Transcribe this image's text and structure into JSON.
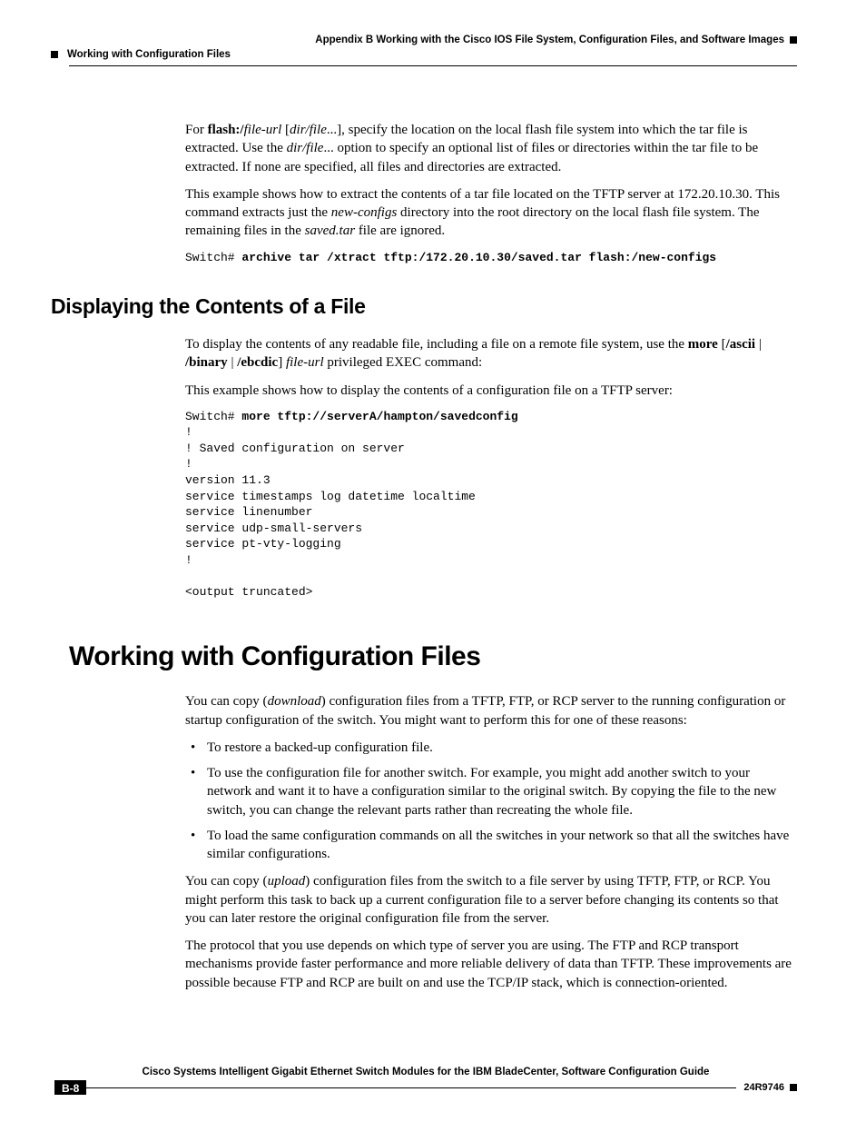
{
  "header": {
    "appendix": "Appendix B      Working with the Cisco IOS File System, Configuration Files, and Software Images",
    "section": "Working with Configuration Files"
  },
  "intro": {
    "p1_pre": "For ",
    "p1_b1": "flash:/",
    "p1_i1": "file-url",
    "p1_mid1": " [",
    "p1_i2": "dir/file",
    "p1_mid2": "...], specify the location on the local flash file system into which the tar file is extracted. Use the ",
    "p1_i3": "dir/file",
    "p1_tail": "... option to specify an optional list of files or directories within the tar file to be extracted. If none are specified, all files and directories are extracted.",
    "p2_pre": "This example shows how to extract the contents of a tar file located on the TFTP server at 172.20.10.30. This command extracts just the ",
    "p2_i1": "new-configs",
    "p2_mid": " directory into the root directory on the local flash file system. The remaining files in the ",
    "p2_i2": "saved.tar",
    "p2_tail": " file are ignored.",
    "code1_prompt": "Switch# ",
    "code1_cmd": "archive tar /xtract tftp:/172.20.10.30/saved.tar flash:/new-configs"
  },
  "sectionA": {
    "title": "Displaying the Contents of a File",
    "p1_pre": "To display the contents of any readable file, including a file on a remote file system, use the ",
    "p1_b1": "more",
    "p1_mid1": " [",
    "p1_b2": "/ascii",
    "p1_mid2": " | ",
    "p1_b3": "/binary",
    "p1_mid3": " | ",
    "p1_b4": "/ebcdic",
    "p1_mid4": "] ",
    "p1_i1": "file-url",
    "p1_tail": " privileged EXEC command:",
    "p2": "This example shows how to display the contents of a configuration file on a TFTP server:",
    "code_prompt": "Switch# ",
    "code_cmd": "more tftp://serverA/hampton/savedconfig",
    "code_body": "!\n! Saved configuration on server\n!\nversion 11.3\nservice timestamps log datetime localtime\nservice linenumber\nservice udp-small-servers\nservice pt-vty-logging\n!\n\n<output truncated>"
  },
  "sectionB": {
    "title": "Working with Configuration Files",
    "p1_pre": "You can copy (",
    "p1_i1": "download",
    "p1_mid": ") configuration files from a TFTP, FTP, or RCP server to the running configuration or startup configuration of the switch. You might want to perform this for one of these reasons:",
    "bullets": [
      "To restore a backed-up configuration file.",
      "To use the configuration file for another switch. For example, you might add another switch to your network and want it to have a configuration similar to the original switch. By copying the file to the new switch, you can change the relevant parts rather than recreating the whole file.",
      "To load the same configuration commands on all the switches in your network so that all the switches have similar configurations."
    ],
    "p2_pre": "You can copy (",
    "p2_i1": "upload",
    "p2_tail": ") configuration files from the switch to a file server by using TFTP, FTP, or RCP. You might perform this task to back up a current configuration file to a server before changing its contents so that you can later restore the original configuration file from the server.",
    "p3": "The protocol that you use depends on which type of server you are using. The FTP and RCP transport mechanisms provide faster performance and more reliable delivery of data than TFTP. These improvements are possible because FTP and RCP are built on and use the TCP/IP stack, which is connection-oriented."
  },
  "footer": {
    "guide": "Cisco Systems Intelligent Gigabit Ethernet Switch Modules for the IBM BladeCenter, Software Configuration Guide",
    "page": "B-8",
    "docnum": "24R9746"
  }
}
